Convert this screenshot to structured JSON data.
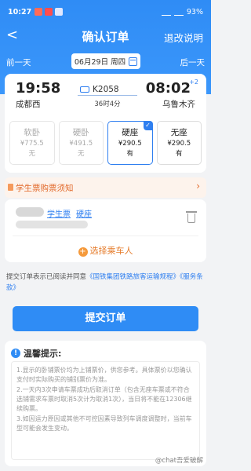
{
  "status": {
    "time": "10:27",
    "battery": "93%"
  },
  "nav": {
    "back": "<",
    "title": "确认订单",
    "help": "退改说明"
  },
  "datebar": {
    "prev": "前一天",
    "date": "06月29日 周四",
    "next": "后一天"
  },
  "trip": {
    "dep_time": "19:58",
    "dep_station": "成都西",
    "train_no": "K2058",
    "duration": "36时4分",
    "arr_time": "08:02",
    "arr_plus": "+2",
    "arr_station": "乌鲁木齐"
  },
  "seats": [
    {
      "name": "软卧",
      "price": "¥775.5",
      "avail": "无"
    },
    {
      "name": "硬卧",
      "price": "¥491.5",
      "avail": "无"
    },
    {
      "name": "硬座",
      "price": "¥290.5",
      "avail": "有"
    },
    {
      "name": "无座",
      "price": "¥290.5",
      "avail": "有"
    }
  ],
  "notice": {
    "text": "学生票购票须知"
  },
  "passenger": {
    "ticket_type": "学生票",
    "seat": "硬座",
    "add_label": "选择乘车人"
  },
  "agree": {
    "prefix": "提交订单表示已阅读并同意",
    "link1": "《国铁集团铁路旅客运输规程》",
    "link2": "《服务条款》"
  },
  "submit_label": "提交订单",
  "tips": {
    "title": "温馨提示:",
    "items": [
      "1.显示的卧铺票价均为上铺票价，供您参考。具体票价以您确认支付时实际购买的铺别票价为准。",
      "2.一天内3次申请车票成功后取消订单（包含无座车票或不符合选铺需求车票时取消5次计为取消1次），当日将不能在12306继续购票。",
      "3.如因运力原因或其他不可控因素导致列车调度调整时，当前车型可能会发生变动。"
    ]
  },
  "watermark": "@chat吾爱破解"
}
